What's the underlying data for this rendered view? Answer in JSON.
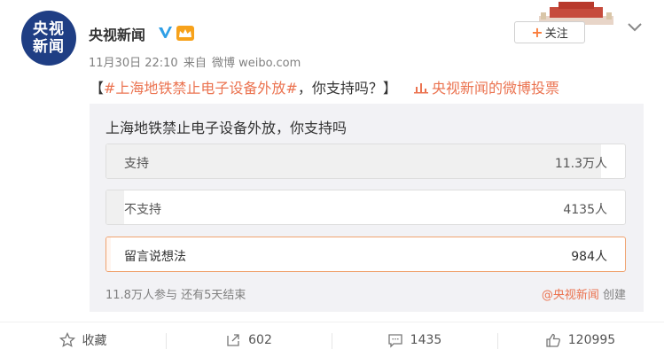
{
  "post": {
    "author": {
      "avatar_text_line1": "央视",
      "avatar_text_line2": "新闻",
      "name": "央视新闻",
      "verified_icon": "verified-badge-icon",
      "member_icon": "vip-member-icon"
    },
    "meta": {
      "date": "11月30日 22:10",
      "source_prefix": "来自",
      "source": "微博 weibo.com"
    },
    "follow_label": "关注",
    "content": {
      "open_bracket": "【",
      "topic": "#上海地铁禁止电子设备外放#",
      "text": "，你支持吗？",
      "close_bracket": "】",
      "vote_link": "央视新闻的微博投票"
    }
  },
  "poll": {
    "title": "上海地铁禁止电子设备外放，你支持吗",
    "options": [
      {
        "label": "支持",
        "count": "11.3万人",
        "share": 0.953
      },
      {
        "label": "不支持",
        "count": "4135人",
        "share": 0.035
      },
      {
        "label": "留言说想法",
        "count": "984人",
        "share": 0.008
      }
    ],
    "participants": "11.8万人参与",
    "remaining": "还有5天结束",
    "creator": "@央视新闻",
    "creator_suffix": "创建"
  },
  "actions": {
    "favorite": "收藏",
    "repost": "602",
    "comment": "1435",
    "like": "120995"
  },
  "colors": {
    "accent": "#eb7350",
    "avatar_bg": "#1f3e84",
    "poll_bg": "#f2f2f5",
    "selected_border": "#f0a370"
  }
}
